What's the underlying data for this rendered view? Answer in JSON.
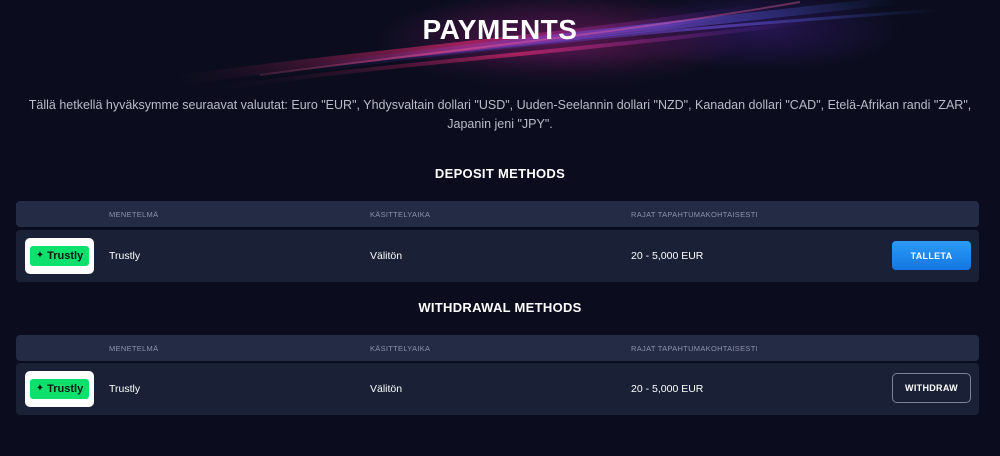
{
  "page": {
    "title": "PAYMENTS",
    "intro": "Tällä hetkellä hyväksymme seuraavat valuutat: Euro \"EUR\", Yhdysvaltain dollari \"USD\", Uuden-Seelannin dollari \"NZD\", Kanadan dollari \"CAD\", Etelä-Afrikan randi \"ZAR\", Japanin jeni \"JPY\"."
  },
  "columns": {
    "method": "MENETELMÄ",
    "processing": "KÄSITTELYAIKA",
    "limits": "RAJAT TAPAHTUMAKOHTAISESTI"
  },
  "deposit": {
    "section_title": "DEPOSIT METHODS",
    "row": {
      "logo_text": "Trustly",
      "name": "Trustly",
      "processing": "Välitön",
      "limits": "20 - 5,000 EUR",
      "button": "TALLETA"
    }
  },
  "withdrawal": {
    "section_title": "WITHDRAWAL METHODS",
    "row": {
      "logo_text": "Trustly",
      "name": "Trustly",
      "processing": "Välitön",
      "limits": "20 - 5,000 EUR",
      "button": "WITHDRAW"
    }
  },
  "colors": {
    "background": "#0b0d1e",
    "trustly_green": "#0ee06e",
    "deposit_button": "#1e88ec"
  },
  "icons": {
    "trustly_logo": "trustly-logo-icon"
  }
}
